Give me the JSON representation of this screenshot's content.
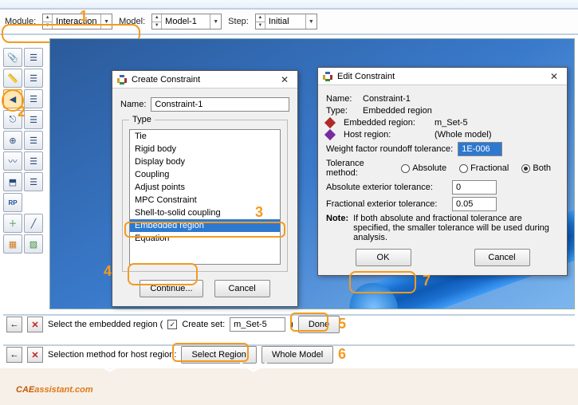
{
  "context": {
    "module_label": "Module:",
    "module_value": "Interaction",
    "model_label": "Model:",
    "model_value": "Model-1",
    "step_label": "Step:",
    "step_value": "Initial"
  },
  "annotations": {
    "a1": "1",
    "a2": "2",
    "a3": "3",
    "a4": "4",
    "a5": "5",
    "a6": "6",
    "a7": "7"
  },
  "create_dialog": {
    "title": "Create Constraint",
    "name_label": "Name:",
    "name_value": "Constraint-1",
    "type_label": "Type",
    "types": [
      "Tie",
      "Rigid body",
      "Display body",
      "Coupling",
      "Adjust points",
      "MPC Constraint",
      "Shell-to-solid coupling",
      "Embedded region",
      "Equation"
    ],
    "selected_type_index": 7,
    "continue_label": "Continue...",
    "cancel_label": "Cancel"
  },
  "edit_dialog": {
    "title": "Edit Constraint",
    "name_label": "Name:",
    "name_value": "Constraint-1",
    "type_label": "Type:",
    "type_value": "Embedded region",
    "embedded_label": "Embedded region:",
    "embedded_value": "m_Set-5",
    "host_label": "Host region:",
    "host_value": "(Whole model)",
    "weight_label": "Weight factor roundoff tolerance:",
    "weight_value": "1E-006",
    "tolmethod_label": "Tolerance method:",
    "tolmethod_options": [
      "Absolute",
      "Fractional",
      "Both"
    ],
    "tolmethod_selected": 2,
    "abs_tol_label": "Absolute exterior tolerance:",
    "abs_tol_value": "0",
    "frac_tol_label": "Fractional exterior tolerance:",
    "frac_tol_value": "0.05",
    "note_label": "Note:",
    "note_text": "If both absolute and fractional tolerance are specified, the smaller tolerance will be used during analysis.",
    "ok_label": "OK",
    "cancel_label": "Cancel"
  },
  "prompt1": {
    "text": "Select the embedded region   (",
    "create_set_label": "Create set:",
    "create_set_checked": true,
    "set_name": "m_Set-5",
    "close_paren": ")",
    "done_label": "Done"
  },
  "prompt2": {
    "text": "Selection method for host region:",
    "select_region_label": "Select Region",
    "whole_model_label": "Whole Model"
  },
  "brand": {
    "cae": "CAE",
    "rest": "assistant.com"
  }
}
